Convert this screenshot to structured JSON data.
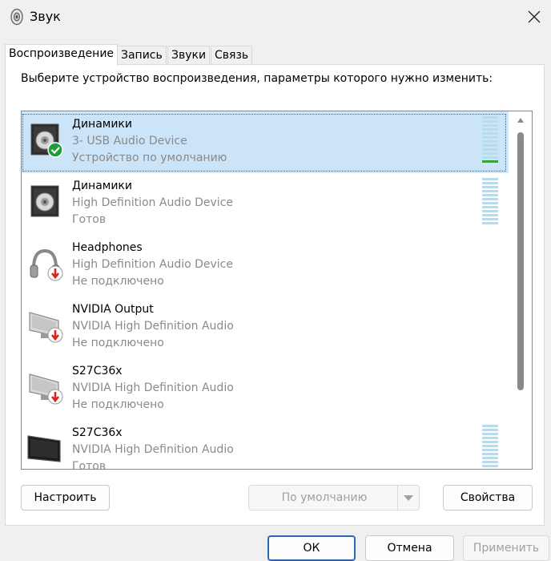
{
  "window": {
    "title": "Звук",
    "icon": "speaker-icon",
    "close_icon": "close-icon"
  },
  "tabs": [
    {
      "label": "Воспроизведение",
      "active": true
    },
    {
      "label": "Запись",
      "active": false
    },
    {
      "label": "Звуки",
      "active": false
    },
    {
      "label": "Связь",
      "active": false
    }
  ],
  "instruction": "Выберите устройство воспроизведения, параметры которого нужно изменить:",
  "devices": [
    {
      "name": "Динамики",
      "desc": "3- USB Audio Device",
      "status": "Устройство по умолчанию",
      "icon": "speaker-icon",
      "badge": "default-check-icon",
      "selected": true,
      "meter": true,
      "level": 0.1
    },
    {
      "name": "Динамики",
      "desc": "High Definition Audio Device",
      "status": "Готов",
      "icon": "speaker-icon",
      "badge": "",
      "selected": false,
      "meter": true,
      "level": 0
    },
    {
      "name": "Headphones",
      "desc": "High Definition Audio Device",
      "status": "Не подключено",
      "icon": "headphones-icon",
      "badge": "unplugged-icon",
      "selected": false,
      "meter": false,
      "level": 0
    },
    {
      "name": "NVIDIA Output",
      "desc": "NVIDIA High Definition Audio",
      "status": "Не подключено",
      "icon": "monitor-icon",
      "badge": "unplugged-icon",
      "selected": false,
      "meter": false,
      "level": 0
    },
    {
      "name": "S27C36x",
      "desc": "NVIDIA High Definition Audio",
      "status": "Не подключено",
      "icon": "monitor-icon",
      "badge": "unplugged-icon",
      "selected": false,
      "meter": false,
      "level": 0
    },
    {
      "name": "S27C36x",
      "desc": "NVIDIA High Definition Audio",
      "status": "Готов",
      "icon": "monitor-dark-icon",
      "badge": "",
      "selected": false,
      "meter": true,
      "level": 0
    }
  ],
  "buttons": {
    "configure": "Настроить",
    "set_default": "По умолчанию",
    "properties": "Свойства",
    "ok": "ОК",
    "cancel": "Отмена",
    "apply": "Применить"
  },
  "colors": {
    "selection": "#cce8ff",
    "check_badge": "#1f9d3a",
    "unplugged_badge": "#d9261c",
    "meter_idle": "#b8dced",
    "meter_active": "#3aa043"
  }
}
